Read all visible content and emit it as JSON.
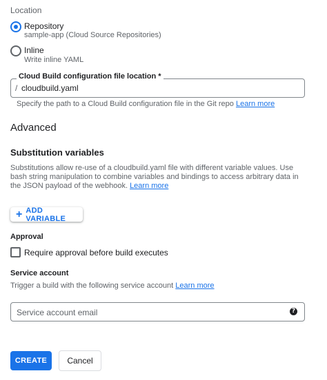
{
  "location": {
    "label": "Location",
    "options": [
      {
        "title": "Repository",
        "subtitle": "sample-app (Cloud Source Repositories)",
        "selected": true
      },
      {
        "title": "Inline",
        "subtitle": "Write inline YAML",
        "selected": false
      }
    ]
  },
  "config_file": {
    "label": "Cloud Build configuration file location *",
    "prefix": "/",
    "value": "cloudbuild.yaml",
    "helper": "Specify the path to a Cloud Build configuration file in the Git repo",
    "helper_link": "Learn more"
  },
  "advanced": {
    "heading": "Advanced"
  },
  "substitutions": {
    "heading": "Substitution variables",
    "description": "Substitutions allow re-use of a cloudbuild.yaml file with different variable values. Use bash string manipulation to combine variables and bindings to access arbitrary data in the JSON payload of the webhook.",
    "link": "Learn more",
    "add_button": "ADD VARIABLE"
  },
  "approval": {
    "heading": "Approval",
    "checkbox_label": "Require approval before build executes",
    "checked": false
  },
  "service_account": {
    "heading": "Service account",
    "description": "Trigger a build with the following service account",
    "link": "Learn more",
    "placeholder": "Service account email",
    "help_glyph": "?"
  },
  "actions": {
    "create": "CREATE",
    "cancel": "Cancel"
  },
  "colors": {
    "accent": "#1a73e8",
    "text": "#202124",
    "secondary_text": "#5f6368"
  }
}
